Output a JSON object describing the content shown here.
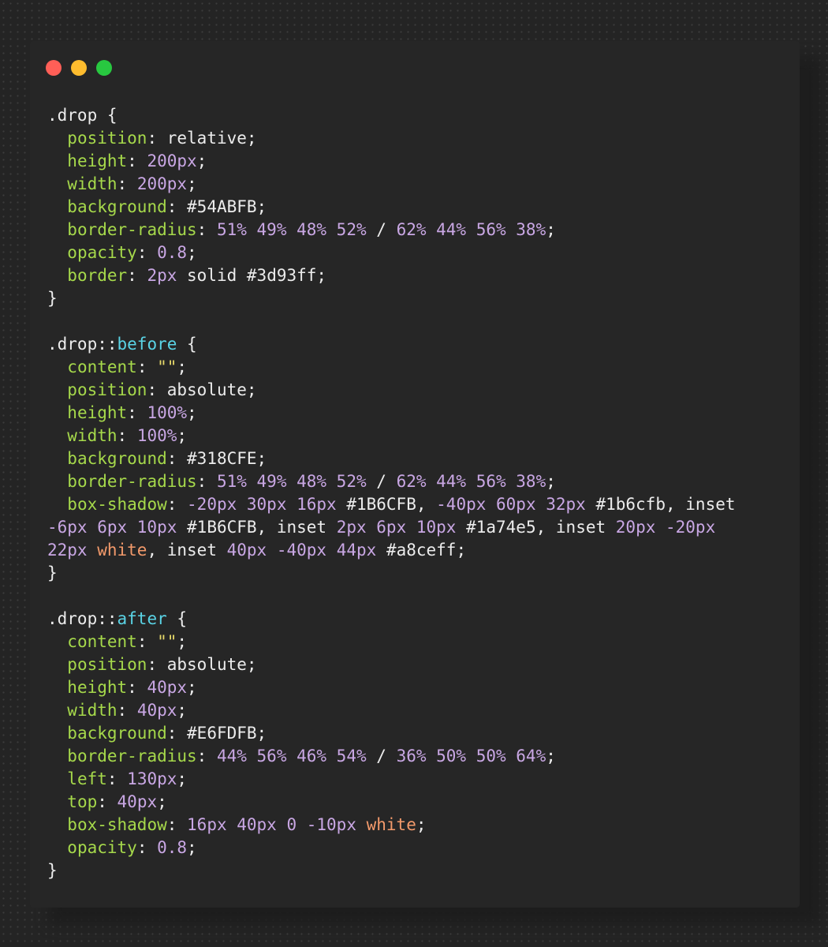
{
  "window": {
    "controls": [
      {
        "name": "close-control",
        "color": "#ff5f57"
      },
      {
        "name": "minimize-control",
        "color": "#febc2e"
      },
      {
        "name": "maximize-control",
        "color": "#28c840"
      }
    ]
  },
  "colors": {
    "background": "#242424",
    "window": "#262626",
    "selector": "#ececec",
    "property": "#a6d94b",
    "number": "#c9a7e4",
    "string": "#e7d96a",
    "pseudo": "#5ad4e6",
    "color_name": "#f39a6b"
  },
  "code": {
    "lines": [
      [
        {
          "t": "sel",
          "v": ".drop"
        },
        {
          "t": "pun",
          "v": " {"
        }
      ],
      [
        {
          "t": "pun",
          "v": "  "
        },
        {
          "t": "prop",
          "v": "position"
        },
        {
          "t": "pun",
          "v": ": "
        },
        {
          "t": "kw",
          "v": "relative"
        },
        {
          "t": "pun",
          "v": ";"
        }
      ],
      [
        {
          "t": "pun",
          "v": "  "
        },
        {
          "t": "prop",
          "v": "height"
        },
        {
          "t": "pun",
          "v": ": "
        },
        {
          "t": "num",
          "v": "200px"
        },
        {
          "t": "pun",
          "v": ";"
        }
      ],
      [
        {
          "t": "pun",
          "v": "  "
        },
        {
          "t": "prop",
          "v": "width"
        },
        {
          "t": "pun",
          "v": ": "
        },
        {
          "t": "num",
          "v": "200px"
        },
        {
          "t": "pun",
          "v": ";"
        }
      ],
      [
        {
          "t": "pun",
          "v": "  "
        },
        {
          "t": "prop",
          "v": "background"
        },
        {
          "t": "pun",
          "v": ": "
        },
        {
          "t": "hex",
          "v": "#54ABFB"
        },
        {
          "t": "pun",
          "v": ";"
        }
      ],
      [
        {
          "t": "pun",
          "v": "  "
        },
        {
          "t": "prop",
          "v": "border-radius"
        },
        {
          "t": "pun",
          "v": ": "
        },
        {
          "t": "num",
          "v": "51% 49% 48% 52%"
        },
        {
          "t": "pun",
          "v": " / "
        },
        {
          "t": "num",
          "v": "62% 44% 56% 38%"
        },
        {
          "t": "pun",
          "v": ";"
        }
      ],
      [
        {
          "t": "pun",
          "v": "  "
        },
        {
          "t": "prop",
          "v": "opacity"
        },
        {
          "t": "pun",
          "v": ": "
        },
        {
          "t": "num",
          "v": "0.8"
        },
        {
          "t": "pun",
          "v": ";"
        }
      ],
      [
        {
          "t": "pun",
          "v": "  "
        },
        {
          "t": "prop",
          "v": "border"
        },
        {
          "t": "pun",
          "v": ": "
        },
        {
          "t": "num",
          "v": "2px"
        },
        {
          "t": "kw",
          "v": " solid "
        },
        {
          "t": "hex",
          "v": "#3d93ff"
        },
        {
          "t": "pun",
          "v": ";"
        }
      ],
      [
        {
          "t": "pun",
          "v": "}"
        }
      ],
      [],
      [
        {
          "t": "sel",
          "v": ".drop::"
        },
        {
          "t": "pse",
          "v": "before"
        },
        {
          "t": "pun",
          "v": " {"
        }
      ],
      [
        {
          "t": "pun",
          "v": "  "
        },
        {
          "t": "prop",
          "v": "content"
        },
        {
          "t": "pun",
          "v": ": "
        },
        {
          "t": "str",
          "v": "\"\""
        },
        {
          "t": "pun",
          "v": ";"
        }
      ],
      [
        {
          "t": "pun",
          "v": "  "
        },
        {
          "t": "prop",
          "v": "position"
        },
        {
          "t": "pun",
          "v": ": "
        },
        {
          "t": "kw",
          "v": "absolute"
        },
        {
          "t": "pun",
          "v": ";"
        }
      ],
      [
        {
          "t": "pun",
          "v": "  "
        },
        {
          "t": "prop",
          "v": "height"
        },
        {
          "t": "pun",
          "v": ": "
        },
        {
          "t": "num",
          "v": "100%"
        },
        {
          "t": "pun",
          "v": ";"
        }
      ],
      [
        {
          "t": "pun",
          "v": "  "
        },
        {
          "t": "prop",
          "v": "width"
        },
        {
          "t": "pun",
          "v": ": "
        },
        {
          "t": "num",
          "v": "100%"
        },
        {
          "t": "pun",
          "v": ";"
        }
      ],
      [
        {
          "t": "pun",
          "v": "  "
        },
        {
          "t": "prop",
          "v": "background"
        },
        {
          "t": "pun",
          "v": ": "
        },
        {
          "t": "hex",
          "v": "#318CFE"
        },
        {
          "t": "pun",
          "v": ";"
        }
      ],
      [
        {
          "t": "pun",
          "v": "  "
        },
        {
          "t": "prop",
          "v": "border-radius"
        },
        {
          "t": "pun",
          "v": ": "
        },
        {
          "t": "num",
          "v": "51% 49% 48% 52%"
        },
        {
          "t": "pun",
          "v": " / "
        },
        {
          "t": "num",
          "v": "62% 44% 56% 38%"
        },
        {
          "t": "pun",
          "v": ";"
        }
      ],
      [
        {
          "t": "pun",
          "v": "  "
        },
        {
          "t": "prop",
          "v": "box-shadow"
        },
        {
          "t": "pun",
          "v": ": "
        },
        {
          "t": "num",
          "v": "-20px 30px 16px"
        },
        {
          "t": "pun",
          "v": " "
        },
        {
          "t": "hex",
          "v": "#1B6CFB"
        },
        {
          "t": "pun",
          "v": ", "
        },
        {
          "t": "num",
          "v": "-40px 60px 32px"
        },
        {
          "t": "pun",
          "v": " "
        },
        {
          "t": "hex",
          "v": "#1b6cfb"
        },
        {
          "t": "pun",
          "v": ", "
        },
        {
          "t": "kw",
          "v": "inset"
        }
      ],
      [
        {
          "t": "num",
          "v": "-6px 6px 10px"
        },
        {
          "t": "pun",
          "v": " "
        },
        {
          "t": "hex",
          "v": "#1B6CFB"
        },
        {
          "t": "pun",
          "v": ", "
        },
        {
          "t": "kw",
          "v": "inset"
        },
        {
          "t": "pun",
          "v": " "
        },
        {
          "t": "num",
          "v": "2px 6px 10px"
        },
        {
          "t": "pun",
          "v": " "
        },
        {
          "t": "hex",
          "v": "#1a74e5"
        },
        {
          "t": "pun",
          "v": ", "
        },
        {
          "t": "kw",
          "v": "inset"
        },
        {
          "t": "pun",
          "v": " "
        },
        {
          "t": "num",
          "v": "20px -20px"
        }
      ],
      [
        {
          "t": "num",
          "v": "22px"
        },
        {
          "t": "pun",
          "v": " "
        },
        {
          "t": "cn",
          "v": "white"
        },
        {
          "t": "pun",
          "v": ", "
        },
        {
          "t": "kw",
          "v": "inset"
        },
        {
          "t": "pun",
          "v": " "
        },
        {
          "t": "num",
          "v": "40px -40px 44px"
        },
        {
          "t": "pun",
          "v": " "
        },
        {
          "t": "hex",
          "v": "#a8ceff"
        },
        {
          "t": "pun",
          "v": ";"
        }
      ],
      [
        {
          "t": "pun",
          "v": "}"
        }
      ],
      [],
      [
        {
          "t": "sel",
          "v": ".drop::"
        },
        {
          "t": "pse",
          "v": "after"
        },
        {
          "t": "pun",
          "v": " {"
        }
      ],
      [
        {
          "t": "pun",
          "v": "  "
        },
        {
          "t": "prop",
          "v": "content"
        },
        {
          "t": "pun",
          "v": ": "
        },
        {
          "t": "str",
          "v": "\"\""
        },
        {
          "t": "pun",
          "v": ";"
        }
      ],
      [
        {
          "t": "pun",
          "v": "  "
        },
        {
          "t": "prop",
          "v": "position"
        },
        {
          "t": "pun",
          "v": ": "
        },
        {
          "t": "kw",
          "v": "absolute"
        },
        {
          "t": "pun",
          "v": ";"
        }
      ],
      [
        {
          "t": "pun",
          "v": "  "
        },
        {
          "t": "prop",
          "v": "height"
        },
        {
          "t": "pun",
          "v": ": "
        },
        {
          "t": "num",
          "v": "40px"
        },
        {
          "t": "pun",
          "v": ";"
        }
      ],
      [
        {
          "t": "pun",
          "v": "  "
        },
        {
          "t": "prop",
          "v": "width"
        },
        {
          "t": "pun",
          "v": ": "
        },
        {
          "t": "num",
          "v": "40px"
        },
        {
          "t": "pun",
          "v": ";"
        }
      ],
      [
        {
          "t": "pun",
          "v": "  "
        },
        {
          "t": "prop",
          "v": "background"
        },
        {
          "t": "pun",
          "v": ": "
        },
        {
          "t": "hex",
          "v": "#E6FDFB"
        },
        {
          "t": "pun",
          "v": ";"
        }
      ],
      [
        {
          "t": "pun",
          "v": "  "
        },
        {
          "t": "prop",
          "v": "border-radius"
        },
        {
          "t": "pun",
          "v": ": "
        },
        {
          "t": "num",
          "v": "44% 56% 46% 54%"
        },
        {
          "t": "pun",
          "v": " / "
        },
        {
          "t": "num",
          "v": "36% 50% 50% 64%"
        },
        {
          "t": "pun",
          "v": ";"
        }
      ],
      [
        {
          "t": "pun",
          "v": "  "
        },
        {
          "t": "prop",
          "v": "left"
        },
        {
          "t": "pun",
          "v": ": "
        },
        {
          "t": "num",
          "v": "130px"
        },
        {
          "t": "pun",
          "v": ";"
        }
      ],
      [
        {
          "t": "pun",
          "v": "  "
        },
        {
          "t": "prop",
          "v": "top"
        },
        {
          "t": "pun",
          "v": ": "
        },
        {
          "t": "num",
          "v": "40px"
        },
        {
          "t": "pun",
          "v": ";"
        }
      ],
      [
        {
          "t": "pun",
          "v": "  "
        },
        {
          "t": "prop",
          "v": "box-shadow"
        },
        {
          "t": "pun",
          "v": ": "
        },
        {
          "t": "num",
          "v": "16px 40px 0 -10px"
        },
        {
          "t": "pun",
          "v": " "
        },
        {
          "t": "cn",
          "v": "white"
        },
        {
          "t": "pun",
          "v": ";"
        }
      ],
      [
        {
          "t": "pun",
          "v": "  "
        },
        {
          "t": "prop",
          "v": "opacity"
        },
        {
          "t": "pun",
          "v": ": "
        },
        {
          "t": "num",
          "v": "0.8"
        },
        {
          "t": "pun",
          "v": ";"
        }
      ],
      [
        {
          "t": "pun",
          "v": "}"
        }
      ]
    ]
  }
}
